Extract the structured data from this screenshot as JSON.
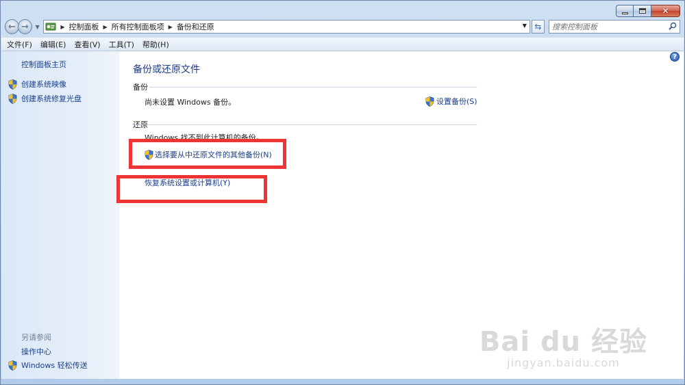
{
  "window": {
    "caption": {
      "minimize": "",
      "maximize": "",
      "close": "✕"
    }
  },
  "navbar": {
    "breadcrumbs": [
      "控制面板",
      "所有控制面板项",
      "备份和还原"
    ],
    "search_placeholder": "搜索控制面板"
  },
  "menubar": {
    "items": [
      "文件(F)",
      "编辑(E)",
      "查看(V)",
      "工具(T)",
      "帮助(H)"
    ]
  },
  "left_pane": {
    "home": "控制面板主页",
    "links": [
      "创建系统映像",
      "创建系统修复光盘"
    ],
    "see_also_title": "另请参阅",
    "see_also_items": [
      "操作中心",
      "Windows 轻松传送"
    ]
  },
  "main": {
    "title": "备份或还原文件",
    "backup": {
      "heading": "备份",
      "status": "尚未设置 Windows 备份。",
      "setup_link": "设置备份(S)"
    },
    "restore": {
      "heading": "还原",
      "status": "Windows 找不到此计算机的备份。",
      "link_other_backup": "选择要从中还原文件的其他备份(N)",
      "link_recover": "恢复系统设置或计算机(Y)"
    }
  },
  "watermark": {
    "logo": "Bai du 经验",
    "url": "jingyan.baidu.com"
  },
  "colors": {
    "link": "#1b3f8b",
    "title": "#1e3a8a",
    "highlight": "#ee3434",
    "left_pane": "#dbe8f8"
  },
  "icons": [
    "back-arrow-icon",
    "forward-arrow-icon",
    "control-panel-icon",
    "refresh-icon",
    "search-icon",
    "shield-icon",
    "help-icon"
  ]
}
